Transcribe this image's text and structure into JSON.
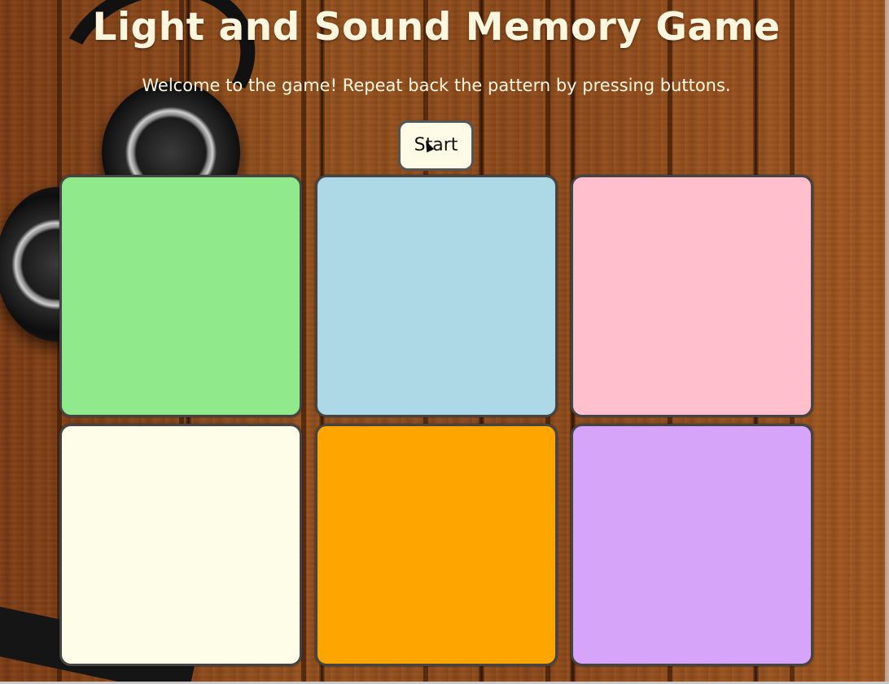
{
  "game": {
    "title": "Light and Sound Memory Game",
    "subtitle": "Welcome to the game! Repeat back the pattern by pressing buttons.",
    "start_label": "Start"
  },
  "pads": [
    {
      "id": "button1",
      "color": "#90ea8b"
    },
    {
      "id": "button2",
      "color": "#add8e6"
    },
    {
      "id": "button3",
      "color": "#ffbfcc"
    },
    {
      "id": "button4",
      "color": "#fdfde8"
    },
    {
      "id": "button5",
      "color": "#ffa500"
    },
    {
      "id": "button6",
      "color": "#d6a4f9"
    }
  ],
  "colors": {
    "text": "#fdf6df",
    "background_wood": "#8a4516",
    "pad_border": "#444444"
  }
}
